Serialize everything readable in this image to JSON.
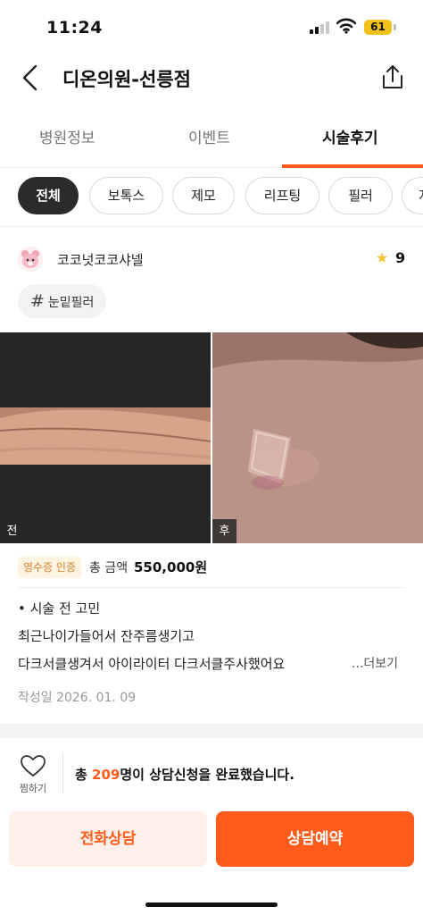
{
  "status_bar": {
    "time": "11:24",
    "battery": "61"
  },
  "header": {
    "title": "디온의원-선릉점"
  },
  "tabs": [
    {
      "label": "병원정보",
      "active": false
    },
    {
      "label": "이벤트",
      "active": false
    },
    {
      "label": "시술후기",
      "active": true
    }
  ],
  "chips": [
    {
      "label": "전체",
      "active": true
    },
    {
      "label": "보톡스",
      "active": false
    },
    {
      "label": "제모",
      "active": false
    },
    {
      "label": "리프팅",
      "active": false
    },
    {
      "label": "필러",
      "active": false
    },
    {
      "label": "지",
      "active": false
    }
  ],
  "review": {
    "author": "코코넛코코샤넬",
    "rating": "9",
    "tag": "눈밑필러",
    "before_label": "전",
    "after_label": "후",
    "receipt_badge": "영수증 인증",
    "price_label": "총 금액",
    "price_value": "550,000원",
    "lines": [
      "• 시술 전 고민",
      "최근나이가들어서 잔주름생기고",
      "다크서클생겨서 아이라이터 다크서클주사했어요"
    ],
    "more_label": "...더보기",
    "date": "작성일 2026. 01. 09"
  },
  "bottom": {
    "like_label": "찜하기",
    "consult_prefix": "총 ",
    "consult_count": "209",
    "consult_suffix": "명이 상담신청을 완료했습니다.",
    "phone_button": "전화상담",
    "reserve_button": "상담예약"
  },
  "colors": {
    "accent": "#ff5c1b",
    "star": "#f6c22b"
  }
}
